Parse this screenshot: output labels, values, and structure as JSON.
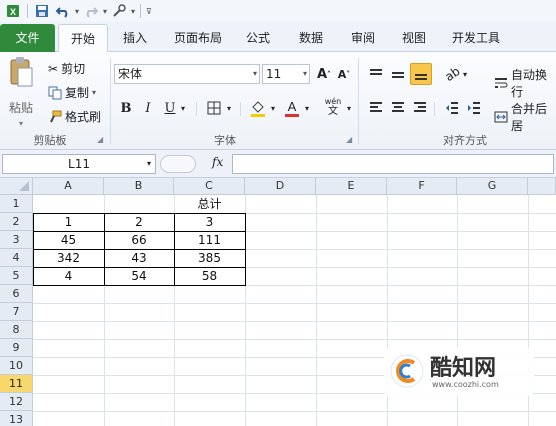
{
  "quick_access": {
    "save_icon": "save-icon",
    "undo_icon": "undo-icon",
    "redo_icon": "redo-icon",
    "customize_icon": "customize-icon"
  },
  "tabs": [
    {
      "label": "文件"
    },
    {
      "label": "开始"
    },
    {
      "label": "插入"
    },
    {
      "label": "页面布局"
    },
    {
      "label": "公式"
    },
    {
      "label": "数据"
    },
    {
      "label": "审阅"
    },
    {
      "label": "视图"
    },
    {
      "label": "开发工具"
    }
  ],
  "ribbon": {
    "clipboard": {
      "paste_label": "粘贴",
      "cut_label": "剪切",
      "copy_label": "复制",
      "format_painter_label": "格式刷",
      "group_label": "剪贴板"
    },
    "font": {
      "font_name": "宋体",
      "font_size": "11",
      "grow_label": "A",
      "shrink_label": "A",
      "bold_label": "B",
      "italic_label": "I",
      "underline_label": "U",
      "wen_label": "wén",
      "group_label": "字体",
      "fill_color": "#f2d000",
      "font_color": "#e03030"
    },
    "alignment": {
      "wrap_label": "自动换行",
      "merge_label": "合并后居",
      "group_label": "对齐方式"
    }
  },
  "formula_bar": {
    "name_box": "L11",
    "fx_label": "fx",
    "formula": ""
  },
  "sheet": {
    "columns": [
      "A",
      "B",
      "C",
      "D",
      "E",
      "F",
      "G"
    ],
    "rows": [
      "1",
      "2",
      "3",
      "4",
      "5",
      "6",
      "7",
      "8",
      "9",
      "10",
      "11",
      "12",
      "13"
    ],
    "selected_row": "11",
    "header_c1": "总计",
    "data": [
      [
        "1",
        "2",
        "3"
      ],
      [
        "45",
        "66",
        "111"
      ],
      [
        "342",
        "43",
        "385"
      ],
      [
        "4",
        "54",
        "58"
      ]
    ]
  },
  "watermark": {
    "brand": "酷知网",
    "url": "www.coozhi.com"
  }
}
